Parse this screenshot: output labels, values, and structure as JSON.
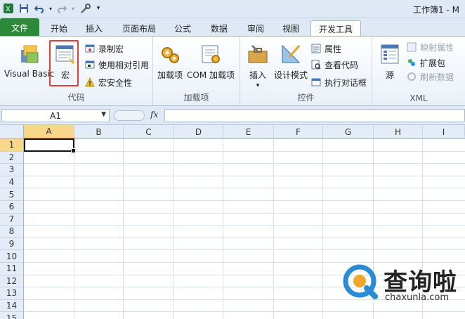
{
  "window": {
    "title": "工作簿1 - M"
  },
  "tabs": [
    {
      "label": "文件"
    },
    {
      "label": "开始"
    },
    {
      "label": "插入"
    },
    {
      "label": "页面布局"
    },
    {
      "label": "公式"
    },
    {
      "label": "数据"
    },
    {
      "label": "审阅"
    },
    {
      "label": "视图"
    },
    {
      "label": "开发工具"
    }
  ],
  "ribbon": {
    "code": {
      "label": "代码",
      "visual_basic": "Visual Basic",
      "macro": "宏",
      "record_macro": "录制宏",
      "relative_ref": "使用相对引用",
      "macro_security": "宏安全性"
    },
    "addins": {
      "label": "加载项",
      "addins_btn": "加载项",
      "com_addins": "COM 加载项"
    },
    "controls": {
      "label": "控件",
      "insert": "插入",
      "design_mode": "设计模式",
      "properties": "属性",
      "view_code": "查看代码",
      "run_dialog": "执行对话框"
    },
    "xml": {
      "label": "XML",
      "source": "源",
      "map_props": "映射属性",
      "expansion": "扩展包",
      "refresh": "刷新数据"
    }
  },
  "formula_bar": {
    "name_box": "A1",
    "fx": "fx",
    "value": ""
  },
  "grid": {
    "columns": [
      "A",
      "B",
      "C",
      "D",
      "E",
      "F",
      "G",
      "H",
      "I"
    ],
    "rows": [
      "1",
      "2",
      "3",
      "4",
      "5",
      "6",
      "7",
      "8",
      "9",
      "10",
      "11",
      "12",
      "13",
      "14",
      "15"
    ],
    "selected_cell": "A1"
  },
  "watermark": {
    "name": "查询啦",
    "url": "chaxunla.com"
  },
  "colors": {
    "file_tab": "#2a8a3a",
    "highlight": "#e0403a",
    "active_header": "#f7d88a"
  }
}
